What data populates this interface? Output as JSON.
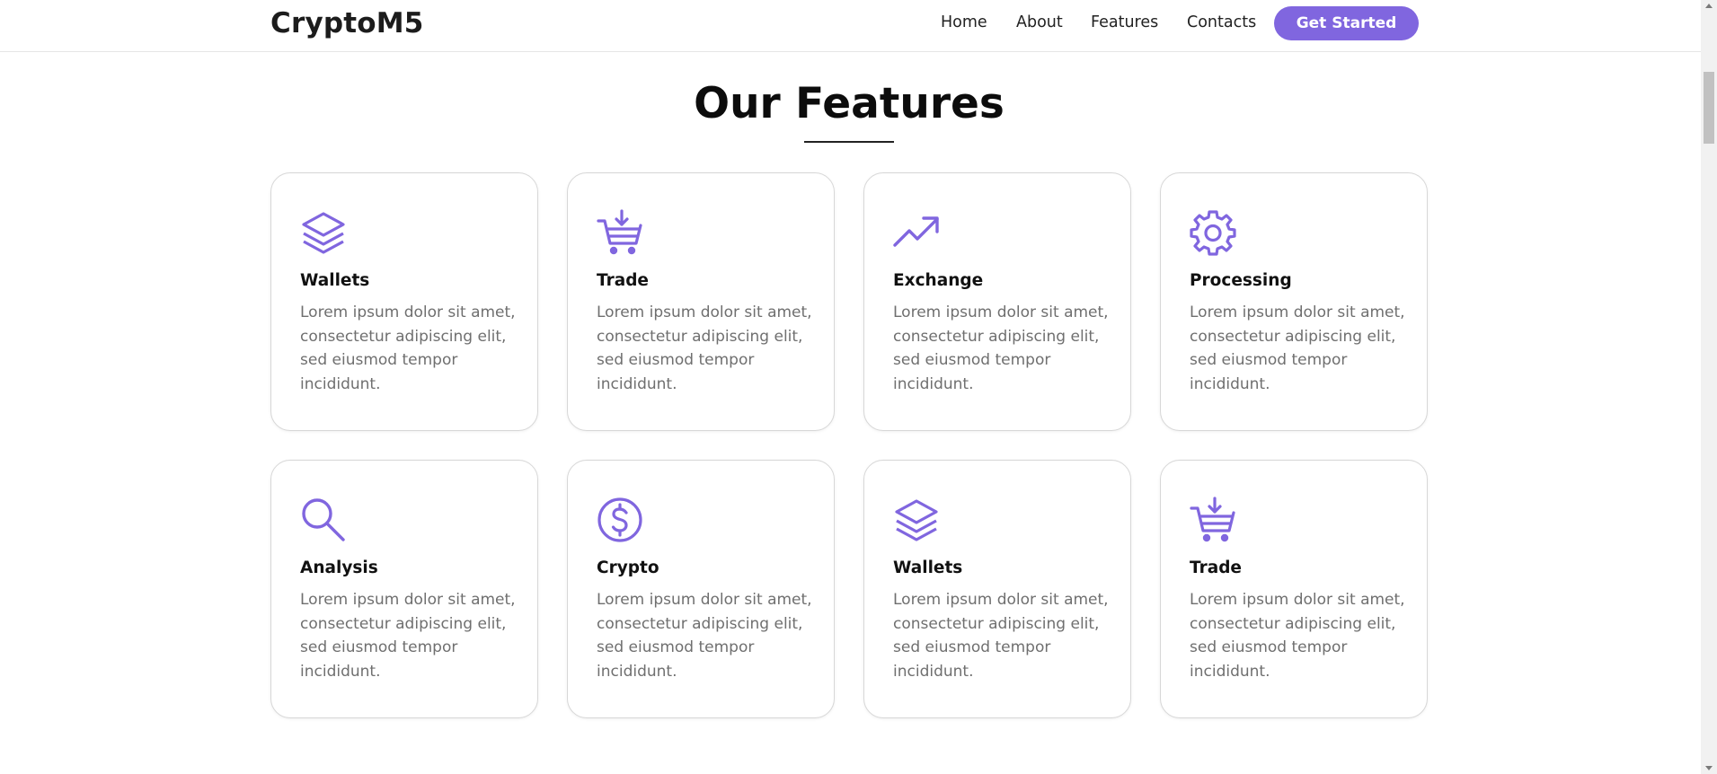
{
  "colors": {
    "accent": "#8066df",
    "text_dark": "#111111",
    "text_muted": "#6f6f6f",
    "card_border": "#d7d7d7"
  },
  "nav": {
    "brand": "CryptoM5",
    "links": [
      "Home",
      "About",
      "Features",
      "Contacts"
    ],
    "cta": "Get Started"
  },
  "section": {
    "title": "Our Features"
  },
  "cards": [
    {
      "icon": "layers-icon",
      "title": "Wallets",
      "desc": "Lorem ipsum dolor sit amet, consectetur adipiscing elit, sed eiusmod tempor incididunt."
    },
    {
      "icon": "cart-download-icon",
      "title": "Trade",
      "desc": "Lorem ipsum dolor sit amet, consectetur adipiscing elit, sed eiusmod tempor incididunt."
    },
    {
      "icon": "trending-up-icon",
      "title": "Exchange",
      "desc": "Lorem ipsum dolor sit amet, consectetur adipiscing elit, sed eiusmod tempor incididunt."
    },
    {
      "icon": "gear-icon",
      "title": "Processing",
      "desc": "Lorem ipsum dolor sit amet, consectetur adipiscing elit, sed eiusmod tempor incididunt."
    },
    {
      "icon": "search-icon",
      "title": "Analysis",
      "desc": "Lorem ipsum dolor sit amet, consectetur adipiscing elit, sed eiusmod tempor incididunt."
    },
    {
      "icon": "dollar-coin-icon",
      "title": "Crypto",
      "desc": "Lorem ipsum dolor sit amet, consectetur adipiscing elit, sed eiusmod tempor incididunt."
    },
    {
      "icon": "layers-icon",
      "title": "Wallets",
      "desc": "Lorem ipsum dolor sit amet, consectetur adipiscing elit, sed eiusmod tempor incididunt."
    },
    {
      "icon": "cart-download-icon",
      "title": "Trade",
      "desc": "Lorem ipsum dolor sit amet, consectetur adipiscing elit, sed eiusmod tempor incididunt."
    }
  ]
}
